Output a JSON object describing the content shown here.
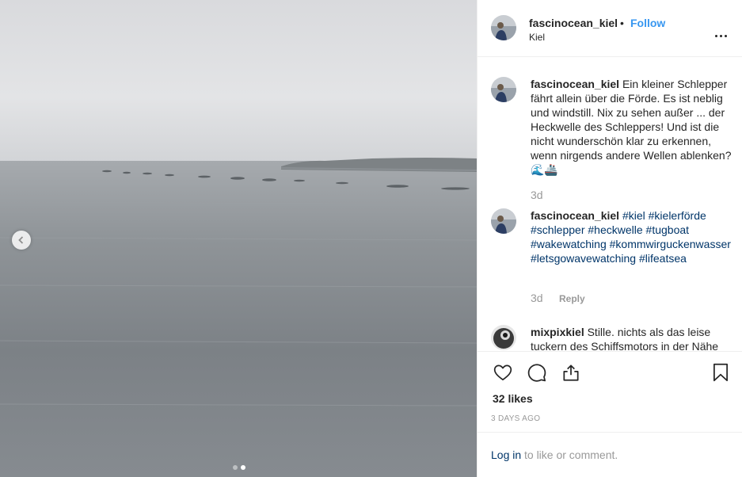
{
  "post": {
    "username": "fascinocean_kiel",
    "separator": "•",
    "follow_label": "Follow",
    "location": "Kiel",
    "more_icon": "more-options-icon"
  },
  "photo": {
    "prev_icon": "chevron-left-icon",
    "slide_count": 2,
    "active_slide": 2
  },
  "comments": [
    {
      "username": "fascinocean_kiel",
      "text": "Ein kleiner Schlepper fährt allein über die Förde. Es ist neblig und windstill. Nix zu sehen außer ... der Heckwelle des Schleppers! Und ist die nicht wunderschön klar zu erkennen, wenn nirgends andere Wellen ablenken? 🌊🚢",
      "time": "3d"
    },
    {
      "username": "fascinocean_kiel",
      "hashtags": [
        "#kiel",
        "#kielerförde",
        "#schlepper",
        "#heckwelle",
        "#tugboat",
        "#wakewatching",
        "#kommwirguckenwasser",
        "#letsgowavewatching",
        "#lifeatsea"
      ],
      "time": "3d",
      "reply_label": "Reply"
    },
    {
      "username": "mixpixkiel",
      "text": "Stille. nichts als das leise tuckern des Schiffsmotors in der Nähe"
    }
  ],
  "actions": {
    "like_icon": "heart-icon",
    "comment_icon": "comment-icon",
    "share_icon": "share-icon",
    "save_icon": "bookmark-icon"
  },
  "likes": "32 likes",
  "posted_ago": "3 DAYS AGO",
  "footer": {
    "login_label": "Log in",
    "login_suffix": "to like or comment."
  },
  "colors": {
    "link_blue": "#3897f0",
    "hashtag": "#003569",
    "muted": "#999999",
    "text": "#262626",
    "border": "#efefef"
  }
}
